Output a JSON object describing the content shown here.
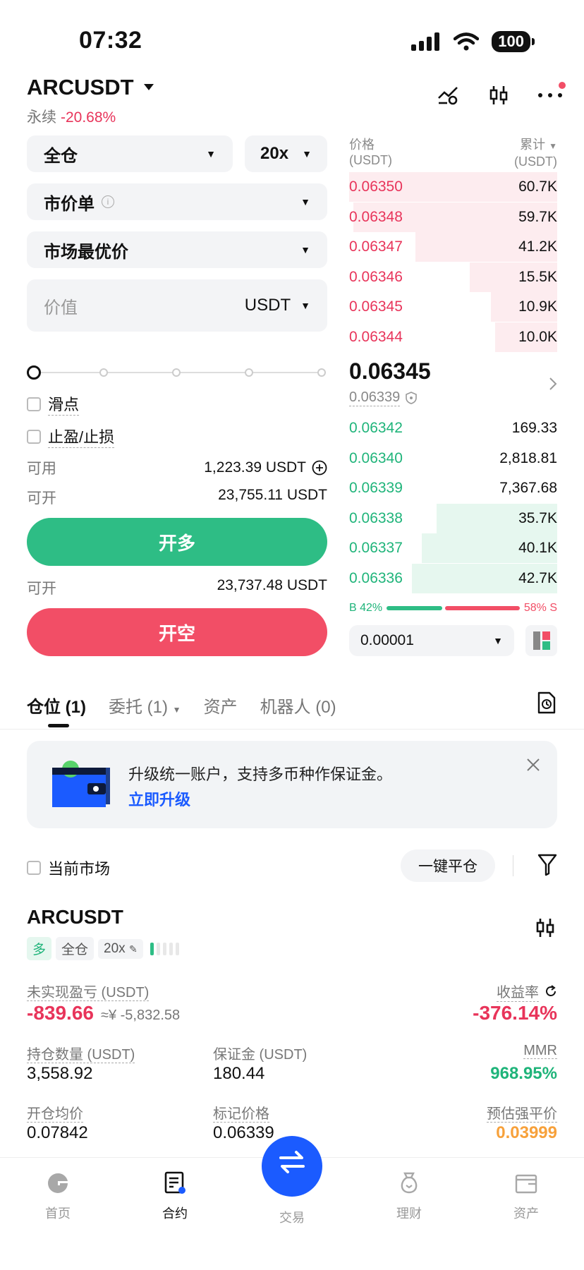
{
  "status_bar": {
    "time": "07:32",
    "battery": "100"
  },
  "header": {
    "pair": "ARCUSDT",
    "type": "永续",
    "change": "-20.68%"
  },
  "order_form": {
    "margin_mode": "全仓",
    "leverage": "20x",
    "order_type": "市价单",
    "price_type": "市场最优价",
    "value_placeholder": "价值",
    "value_unit": "USDT",
    "slippage_label": "滑点",
    "tp_sl_label": "止盈/止损",
    "available_label": "可用",
    "available_value": "1,223.39 USDT",
    "open_long_label": "可开",
    "open_long_value": "23,755.11 USDT",
    "long_button": "开多",
    "open_short_label": "可开",
    "open_short_value": "23,737.48 USDT",
    "short_button": "开空"
  },
  "orderbook": {
    "price_header": "价格",
    "price_unit": "(USDT)",
    "total_header": "累计",
    "total_unit": "(USDT)",
    "asks": [
      {
        "price": "0.06350",
        "qty": "60.7K",
        "depth": 1.0
      },
      {
        "price": "0.06348",
        "qty": "59.7K",
        "depth": 0.98
      },
      {
        "price": "0.06347",
        "qty": "41.2K",
        "depth": 0.68
      },
      {
        "price": "0.06346",
        "qty": "15.5K",
        "depth": 0.42
      },
      {
        "price": "0.06345",
        "qty": "10.9K",
        "depth": 0.32
      },
      {
        "price": "0.06344",
        "qty": "10.0K",
        "depth": 0.3
      }
    ],
    "last_price": "0.06345",
    "mark_price": "0.06339",
    "bids": [
      {
        "price": "0.06342",
        "qty": "169.33",
        "depth": 0
      },
      {
        "price": "0.06340",
        "qty": "2,818.81",
        "depth": 0
      },
      {
        "price": "0.06339",
        "qty": "7,367.68",
        "depth": 0
      },
      {
        "price": "0.06338",
        "qty": "35.7K",
        "depth": 0.58
      },
      {
        "price": "0.06337",
        "qty": "40.1K",
        "depth": 0.65
      },
      {
        "price": "0.06336",
        "qty": "42.7K",
        "depth": 0.7
      }
    ],
    "buy_ratio": "B 42%",
    "sell_ratio": "58% S",
    "buy_ratio_value": 0.42,
    "precision": "0.00001"
  },
  "tabs": [
    {
      "label": "仓位 (1)"
    },
    {
      "label": "委托 (1)"
    },
    {
      "label": "资产"
    },
    {
      "label": "机器人 (0)"
    }
  ],
  "banner": {
    "text": "升级统一账户，支持多币种作保证金。",
    "link": "立即升级"
  },
  "filter": {
    "current_market": "当前市场",
    "close_all": "一键平仓"
  },
  "position": {
    "pair": "ARCUSDT",
    "side": "多",
    "mode": "全仓",
    "leverage": "20x",
    "pnl_label": "未实现盈亏 (USDT)",
    "pnl_value": "-839.66",
    "pnl_cny": "≈¥ -5,832.58",
    "roi_label": "收益率",
    "roi_value": "-376.14%",
    "size_label": "持仓数量 (USDT)",
    "size_value": "3,558.92",
    "margin_label": "保证金 (USDT)",
    "margin_value": "180.44",
    "mmr_label": "MMR",
    "mmr_value": "968.95%",
    "entry_label": "开仓均价",
    "entry_value": "0.07842",
    "mark_label": "标记价格",
    "mark_value": "0.06339",
    "liq_label": "预估强平价",
    "liq_value": "0.03999"
  },
  "bottom_nav": [
    {
      "label": "首页"
    },
    {
      "label": "合约"
    },
    {
      "label": "交易"
    },
    {
      "label": "理财"
    },
    {
      "label": "资产"
    }
  ],
  "colors": {
    "green": "#2ebd85",
    "red": "#f24e66",
    "blue": "#1b5bff",
    "orange": "#f7a13b"
  }
}
